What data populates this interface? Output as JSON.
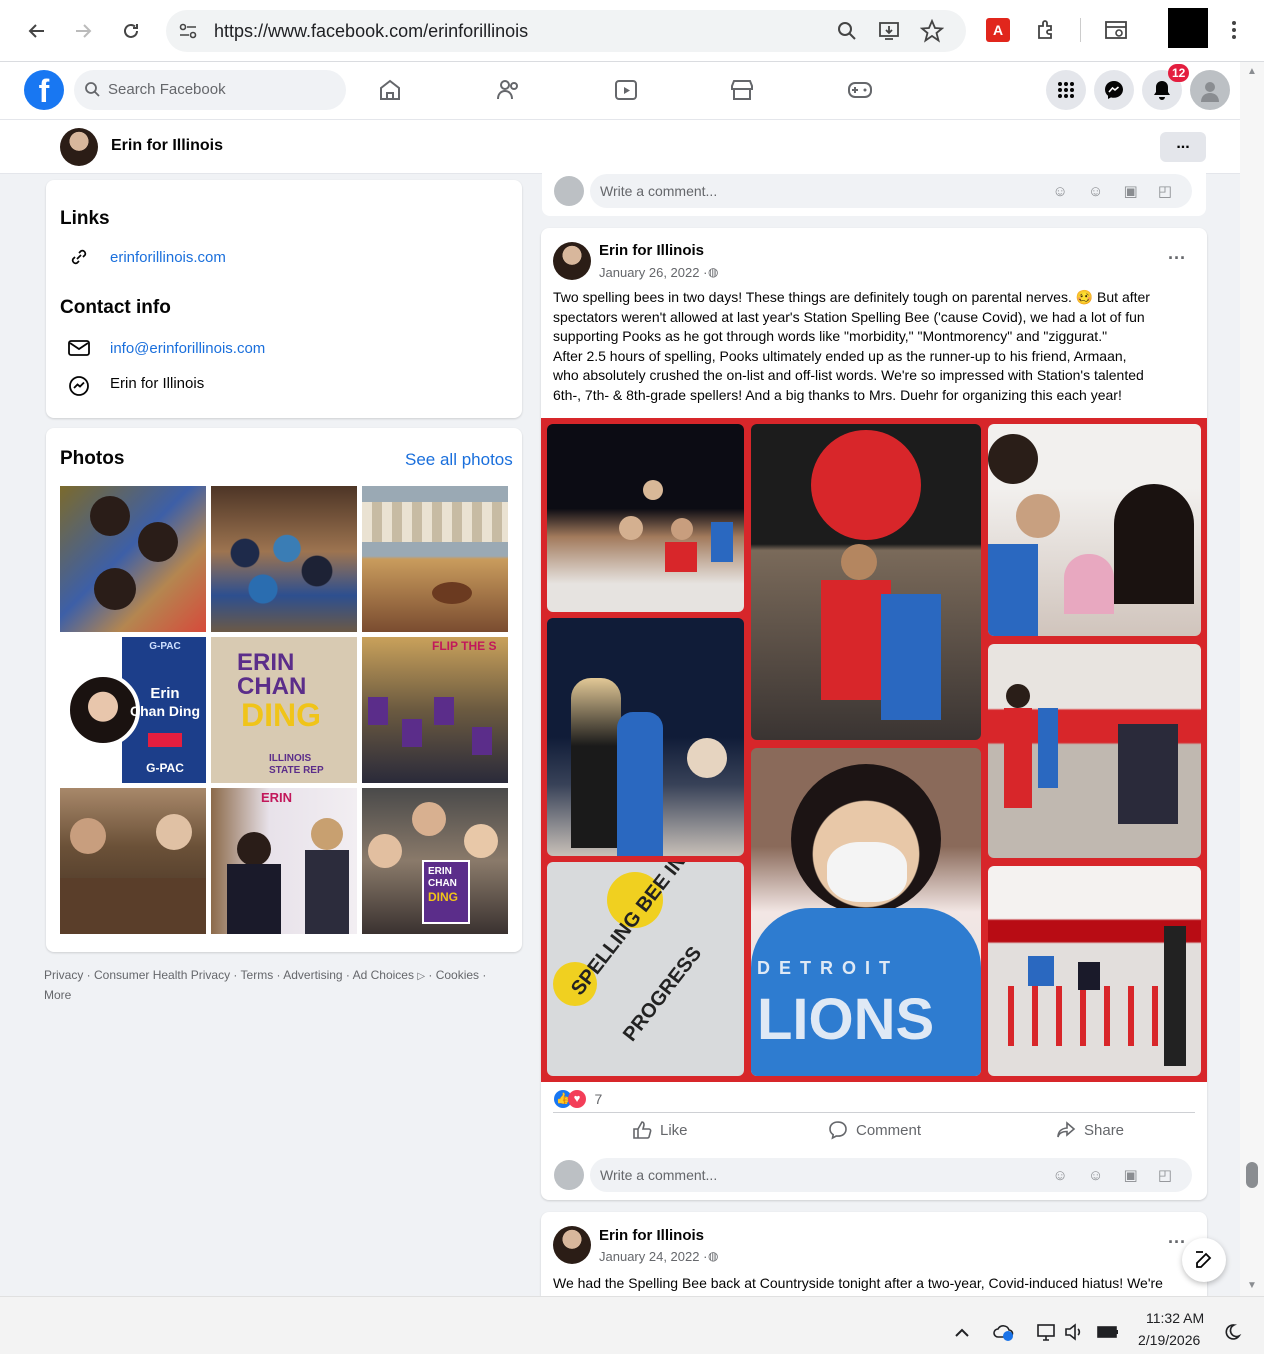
{
  "browser": {
    "url": "https://www.facebook.com/erinforillinois",
    "icons": [
      "back-icon",
      "forward-icon",
      "reload-icon",
      "site-info-icon",
      "zoom-icon",
      "install-icon",
      "star-icon",
      "pdf-icon",
      "extensions-icon",
      "reading-mode-icon",
      "menu-icon"
    ]
  },
  "fb_header": {
    "search_placeholder": "Search Facebook",
    "notification_count": "12",
    "brand_color": "#1877f2"
  },
  "page_bar": {
    "name": "Erin for Illinois",
    "more": "..."
  },
  "intro": {
    "links_heading": "Links",
    "website": "erinforillinois.com",
    "contact_heading": "Contact info",
    "email": "info@erinforillinois.com",
    "messenger": "Erin for Illinois"
  },
  "photos": {
    "heading": "Photos",
    "see_all": "See all photos",
    "tile_texts": {
      "t4_line1": "G-PAC",
      "t4_name1": "Erin",
      "t4_name2": "Chan Ding",
      "t4_footer": "G-PAC",
      "t5_line1": "ERIN",
      "t5_line2": "CHAN",
      "t5_line3": "DING",
      "t5_sub1": "ILLINOIS",
      "t5_sub2": "STATE REP",
      "t6_banner": "FLIP THE S",
      "t8_sign": "ERIN",
      "t9_sign1": "ERIN",
      "t9_sign2": "CHAN",
      "t9_sign3": "DING"
    }
  },
  "footer": {
    "links": [
      "Privacy",
      "Consumer Health Privacy",
      "Terms",
      "Advertising",
      "Ad Choices",
      "Cookies",
      "More"
    ]
  },
  "comment": {
    "placeholder": "Write a comment..."
  },
  "post1": {
    "author": "Erin for Illinois",
    "date": "January 26, 2022 ·",
    "line1": "Two spelling bees in two days! These things are definitely tough on parental nerves. 🥴 But after",
    "line2": "spectators weren't allowed at last year's Station Spelling Bee ('cause Covid), we had a lot of fun",
    "line3": "supporting Pooks as he got through words like \"morbidity,\" \"Montmorency\" and \"ziggurat.\"",
    "line4": "  After 2.5 hours of spelling, Pooks ultimately ended up as the runner-up to his friend, Armaan,",
    "line5": "who absolutely crushed the on-list and off-list words. We're so impressed with Station's talented",
    "line6": "6th-, 7th- & 8th-grade spellers! And a big thanks to Mrs. Duehr for organizing this each year!",
    "sign_text1": "SPELLING BEE IN",
    "sign_text2": "PROGRESS",
    "shirt_text1": "D E T R O I T",
    "shirt_text2": "LIONS",
    "reaction_count": "7",
    "like": "Like",
    "comment": "Comment",
    "share": "Share"
  },
  "post2": {
    "author": "Erin for Illinois",
    "date": "January 24, 2022 ·",
    "line1": "We had the Spelling Bee back at Countryside tonight after a two-year, Covid-induced hiatus! We're"
  },
  "taskbar": {
    "time": "11:32 AM",
    "date": "2/19/2026"
  }
}
